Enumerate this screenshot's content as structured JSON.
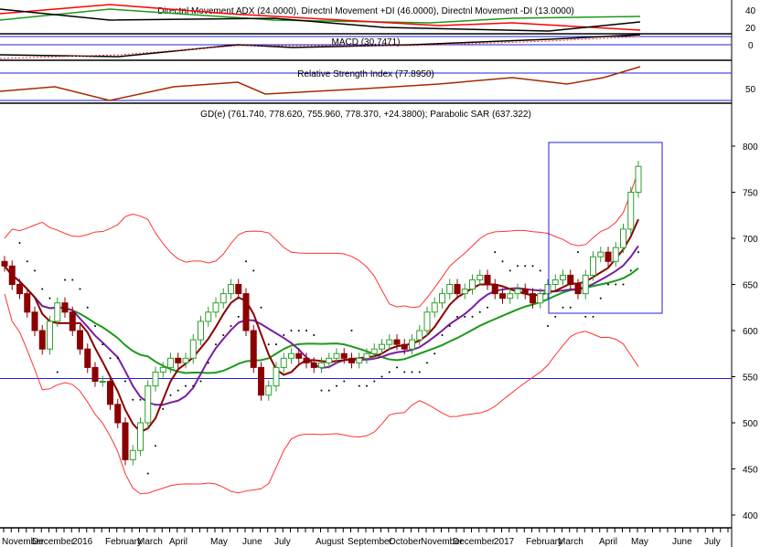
{
  "chart_data": {
    "type": "candlestick",
    "title": "GD(e) (761.740, 778.620, 755.960, 778.370, +24.3800); Parabolic SAR (637.322)",
    "panels": {
      "adx": {
        "title": "Directnl Movement ADX (24.0000), Directnl Movement +DI (46.0000), Directnl Movement -DI (13.0000)",
        "ticks": [
          "40",
          "20"
        ]
      },
      "macd": {
        "title": "MACD (30.7471)",
        "ticks": [
          "0"
        ]
      },
      "rsi": {
        "title": "Relative Strength Index (77.8950)",
        "ticks": [
          "50"
        ]
      }
    },
    "price_ticks": [
      400,
      450,
      500,
      550,
      600,
      650,
      700,
      750,
      800
    ],
    "ylim": [
      390,
      810
    ],
    "support_line": 548,
    "x_labels": [
      "November",
      "December",
      "2016",
      "February",
      "March",
      "April",
      "May",
      "June",
      "July",
      "August",
      "September",
      "October",
      "November",
      "December",
      "2017",
      "February",
      "March",
      "April",
      "May",
      "June",
      "July"
    ],
    "closes": [
      670,
      650,
      640,
      620,
      600,
      580,
      610,
      630,
      620,
      600,
      580,
      560,
      545,
      545,
      520,
      500,
      460,
      470,
      500,
      540,
      555,
      560,
      570,
      565,
      570,
      590,
      610,
      620,
      630,
      640,
      650,
      640,
      600,
      560,
      530,
      540,
      560,
      570,
      575,
      570,
      565,
      560,
      565,
      570,
      575,
      570,
      565,
      570,
      575,
      580,
      585,
      590,
      585,
      580,
      590,
      600,
      620,
      630,
      640,
      650,
      640,
      645,
      655,
      660,
      650,
      640,
      635,
      640,
      645,
      640,
      630,
      640,
      650,
      655,
      660,
      650,
      640,
      660,
      680,
      685,
      675,
      690,
      710,
      750,
      778
    ],
    "colors": {
      "up": "#2e9e2e",
      "down": "#8b0000",
      "ma_short": "#8b0000",
      "ma_mid": "#7a1fa2",
      "ma_long": "#1a9a1a",
      "bands": "#ff3333",
      "blue": "#2020e0"
    }
  }
}
